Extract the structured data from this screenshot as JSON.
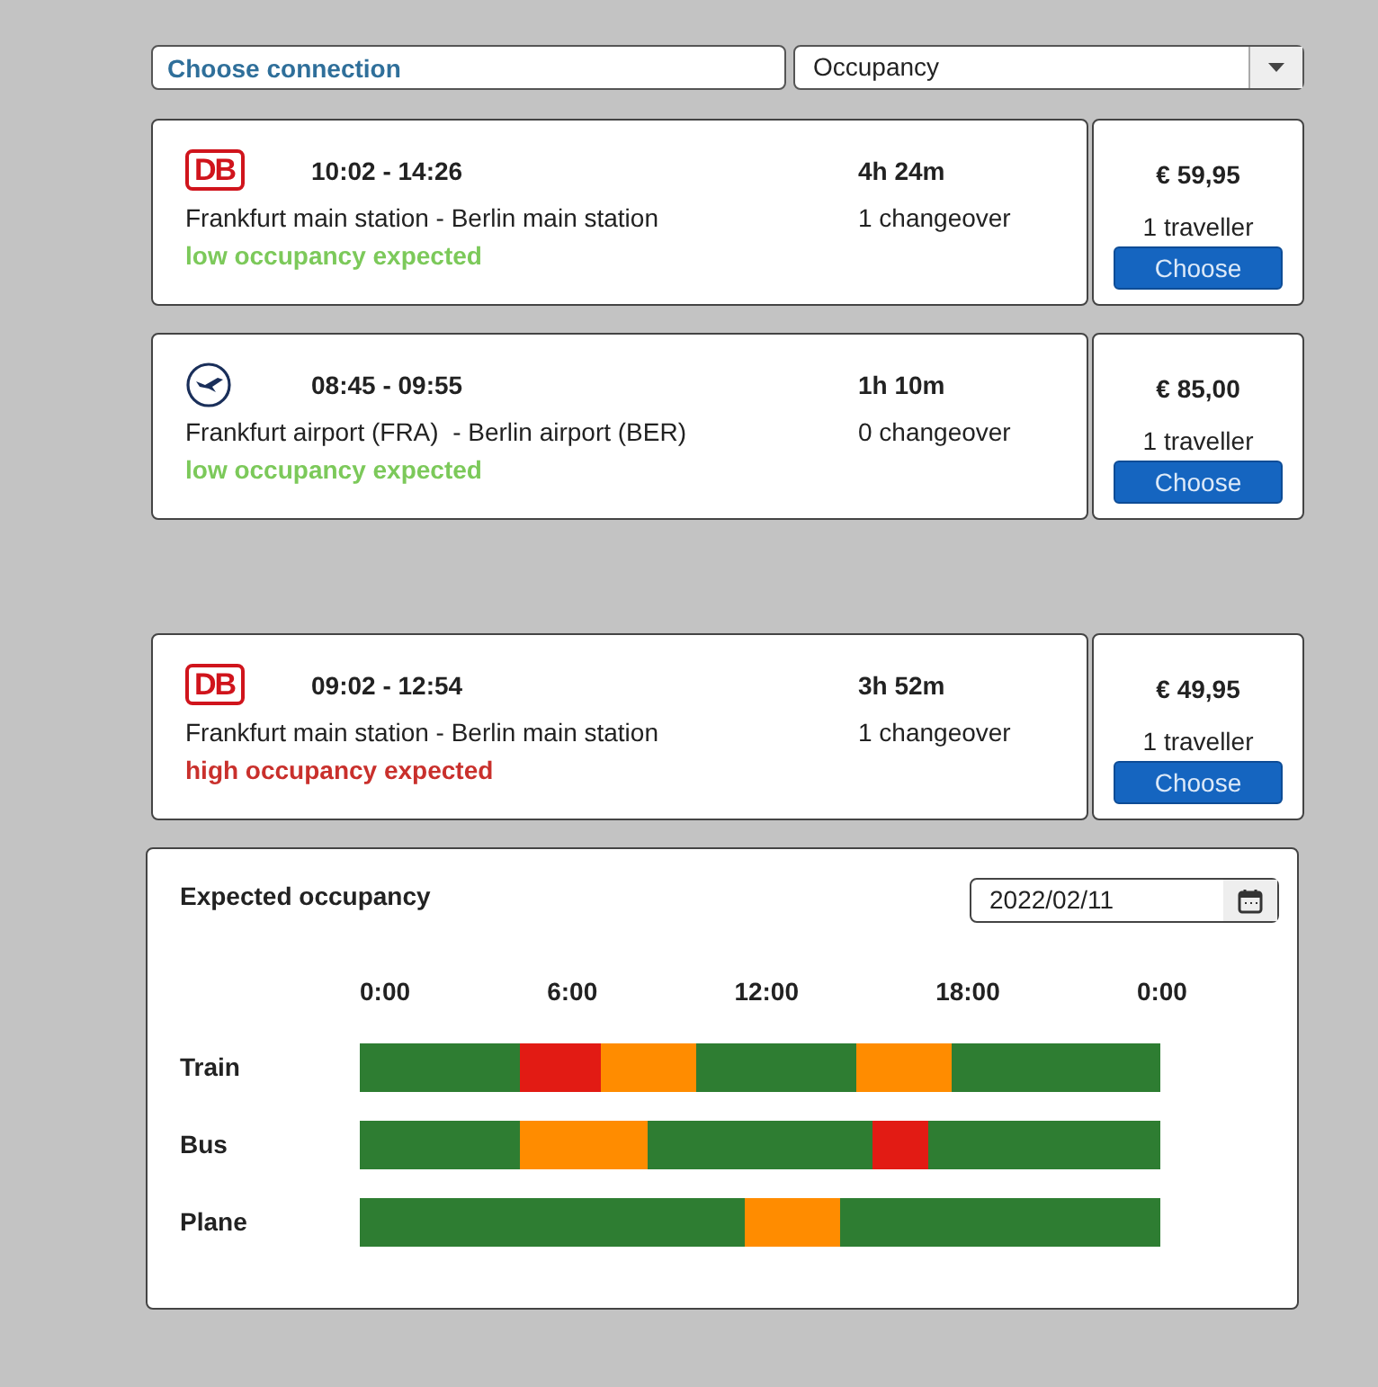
{
  "filter": {
    "connection_value": "Choose connection",
    "sort_value": "Occupancy"
  },
  "connections": [
    {
      "kind": "train",
      "logo_text": "DB",
      "times": "10:02 - 14:26",
      "duration": "4h 24m",
      "route": "Frankfurt main station - Berlin main station",
      "changeovers": "1 changeover",
      "occupancy": "low occupancy expected",
      "color": "#7cc95a",
      "price": "€ 59,95",
      "travellers": "1 traveller",
      "button": "Choose"
    },
    {
      "kind": "plane",
      "times": "08:45 - 09:55",
      "duration": "1h 10m",
      "route": "Frankfurt airport (FRA)  - Berlin airport (BER)",
      "changeovers": "0 changeover",
      "occupancy": "low occupancy expected",
      "color": "#7cc95a",
      "price": "€ 85,00",
      "travellers": "1 traveller",
      "button": "Choose"
    },
    {
      "kind": "train",
      "logo_text": "DB",
      "times": "09:02 - 12:54",
      "duration": "3h 52m",
      "route": "Frankfurt main station - Berlin main station",
      "changeovers": "1 changeover",
      "occupancy": "high occupancy expected",
      "color": "#c9302c",
      "price": "€ 49,95",
      "travellers": "1 traveller",
      "button": "Choose"
    }
  ],
  "occupancy_panel": {
    "title": "Expected occupancy",
    "date": "2022/02/11",
    "hours": [
      "0:00",
      "6:00",
      "12:00",
      "18:00",
      "0:00"
    ],
    "rows": [
      {
        "label": "Train",
        "segments": [
          {
            "color": "#2e7d32"
          },
          {
            "color": "#e21b14"
          },
          {
            "color": "#ff8c00"
          },
          {
            "color": "#2e7d32"
          },
          {
            "color": "#ff8c00"
          },
          {
            "color": "#2e7d32"
          }
        ]
      },
      {
        "label": "Bus",
        "segments": [
          {
            "color": "#2e7d32"
          },
          {
            "color": "#ff8c00"
          },
          {
            "color": "#2e7d32"
          },
          {
            "color": "#e21b14"
          },
          {
            "color": "#2e7d32"
          }
        ]
      },
      {
        "label": "Plane",
        "segments": [
          {
            "color": "#2e7d32"
          },
          {
            "color": "#ff8c00"
          },
          {
            "color": "#2e7d32"
          }
        ]
      }
    ]
  }
}
